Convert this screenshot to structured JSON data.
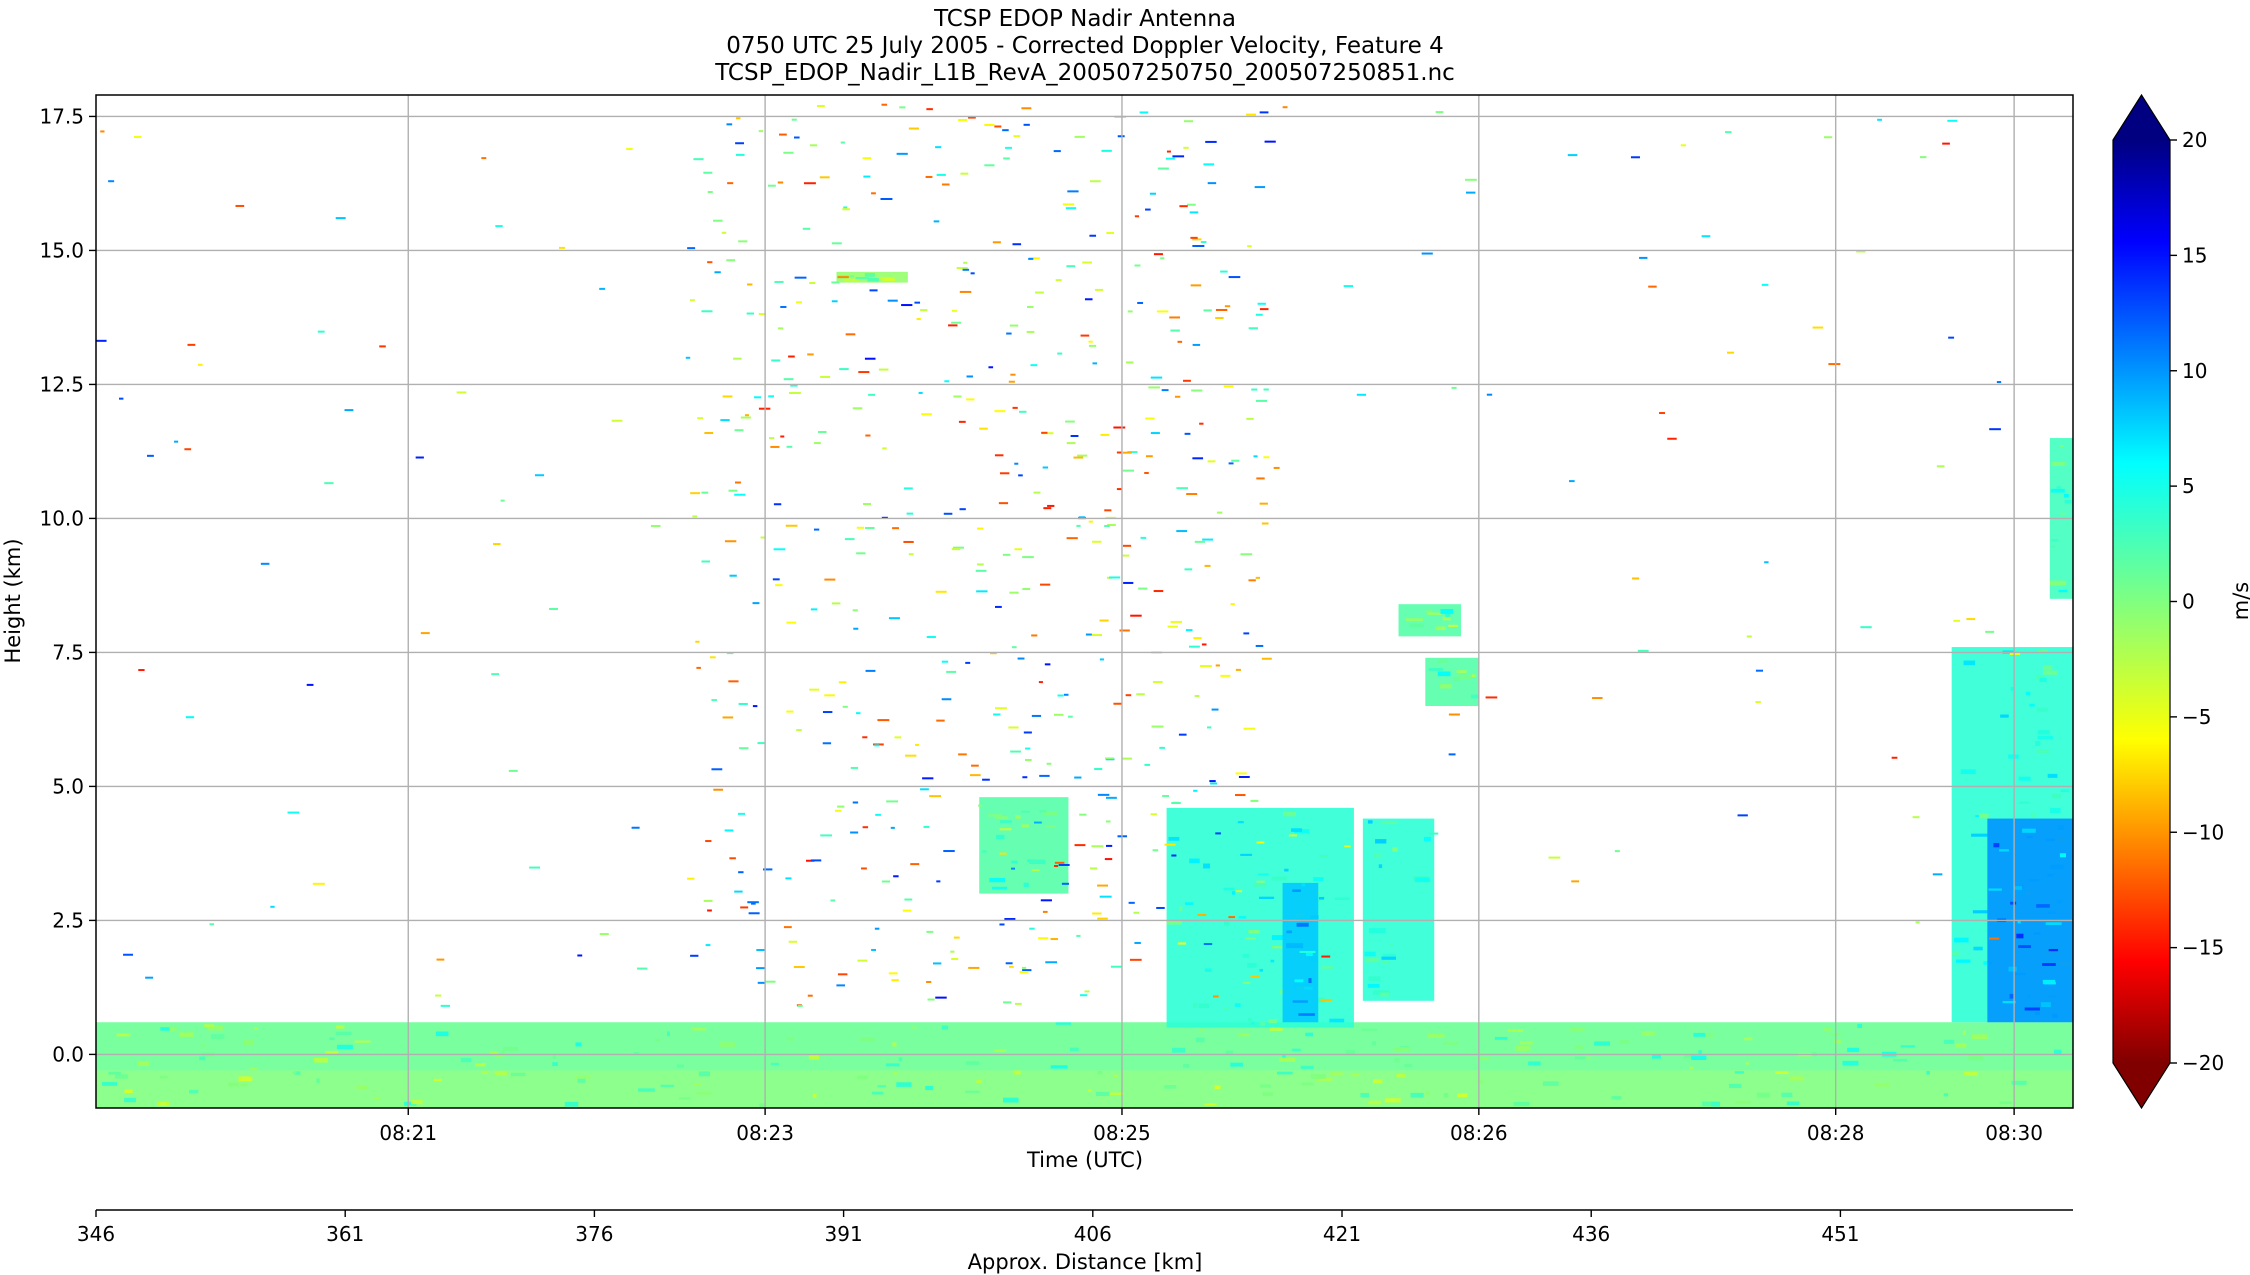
{
  "chart_data": {
    "type": "heatmap",
    "title_lines": [
      "TCSP EDOP Nadir Antenna",
      "0750 UTC 25 July 2005 - Corrected Doppler Velocity, Feature 4",
      "TCSP_EDOP_Nadir_L1B_RevA_200507250750_200507250851.nc"
    ],
    "xlabel": "Time (UTC)",
    "ylabel": "Height (km)",
    "x2label": "Approx. Distance [km]",
    "colorbar_label": "m/s",
    "grid": true,
    "ylim": [
      -1.0,
      17.9
    ],
    "yticks": [
      {
        "value": 0.0,
        "label": "0.0"
      },
      {
        "value": 2.5,
        "label": "2.5"
      },
      {
        "value": 5.0,
        "label": "5.0"
      },
      {
        "value": 7.5,
        "label": "7.5"
      },
      {
        "value": 10.0,
        "label": "10.0"
      },
      {
        "value": 12.5,
        "label": "12.5"
      },
      {
        "value": 15.0,
        "label": "15.0"
      },
      {
        "value": 17.5,
        "label": "17.5"
      }
    ],
    "xlim_minutes": [
      499.25,
      510.33
    ],
    "xticks": [
      {
        "value": 501.0,
        "label": "08:21"
      },
      {
        "value": 503.0,
        "label": "08:23"
      },
      {
        "value": 505.0,
        "label": "08:25"
      },
      {
        "value": 507.0,
        "label": "08:26"
      },
      {
        "value": 509.0,
        "label": "08:28"
      },
      {
        "value": 510.0,
        "label": "08:30"
      }
    ],
    "distance_range_km": [
      346,
      465
    ],
    "distance_ticks": [
      "346",
      "361",
      "376",
      "391",
      "406",
      "421",
      "436",
      "451"
    ],
    "colorbar": {
      "vmin": -20,
      "vmax": 20,
      "ticks": [
        {
          "value": 20,
          "label": "20"
        },
        {
          "value": 15,
          "label": "15"
        },
        {
          "value": 10,
          "label": "10"
        },
        {
          "value": 5,
          "label": "5"
        },
        {
          "value": 0,
          "label": "0"
        },
        {
          "value": -5,
          "label": "−5"
        },
        {
          "value": -10,
          "label": "−10"
        },
        {
          "value": -15,
          "label": "−15"
        },
        {
          "value": -20,
          "label": "−20"
        }
      ],
      "colormap": "jet_r",
      "extend": "both"
    },
    "features": [
      {
        "kind": "surface_band",
        "t": [
          499.25,
          510.33
        ],
        "h": [
          -0.3,
          0.6
        ],
        "velocity": 1
      },
      {
        "kind": "surface_clutter",
        "t": [
          499.25,
          510.33
        ],
        "h": [
          -1.0,
          -0.3
        ],
        "velocity": 0
      },
      {
        "kind": "echo",
        "t": [
          505.25,
          506.3
        ],
        "h": [
          0.5,
          4.6
        ],
        "velocity": 4
      },
      {
        "kind": "echo_core",
        "t": [
          505.9,
          506.1
        ],
        "h": [
          0.6,
          3.2
        ],
        "velocity": 8
      },
      {
        "kind": "echo_streak",
        "t": [
          506.35,
          506.75
        ],
        "h": [
          1.0,
          4.4
        ],
        "velocity": 4
      },
      {
        "kind": "echo_patch",
        "t": [
          504.2,
          504.7
        ],
        "h": [
          3.0,
          4.8
        ],
        "velocity": 2
      },
      {
        "kind": "echo_patch",
        "t": [
          506.55,
          506.9
        ],
        "h": [
          7.8,
          8.4
        ],
        "velocity": 2
      },
      {
        "kind": "echo_patch",
        "t": [
          506.7,
          507.0
        ],
        "h": [
          6.5,
          7.4
        ],
        "velocity": 2
      },
      {
        "kind": "echo",
        "t": [
          509.65,
          510.33
        ],
        "h": [
          0.6,
          7.6
        ],
        "velocity": 4
      },
      {
        "kind": "echo_core",
        "t": [
          509.85,
          510.33
        ],
        "h": [
          0.6,
          4.4
        ],
        "velocity": 10
      },
      {
        "kind": "echo",
        "t": [
          510.2,
          510.33
        ],
        "h": [
          8.5,
          11.5
        ],
        "velocity": 3
      },
      {
        "kind": "echo_streak",
        "t": [
          503.4,
          503.8
        ],
        "h": [
          14.4,
          14.6
        ],
        "velocity": -1
      }
    ]
  }
}
